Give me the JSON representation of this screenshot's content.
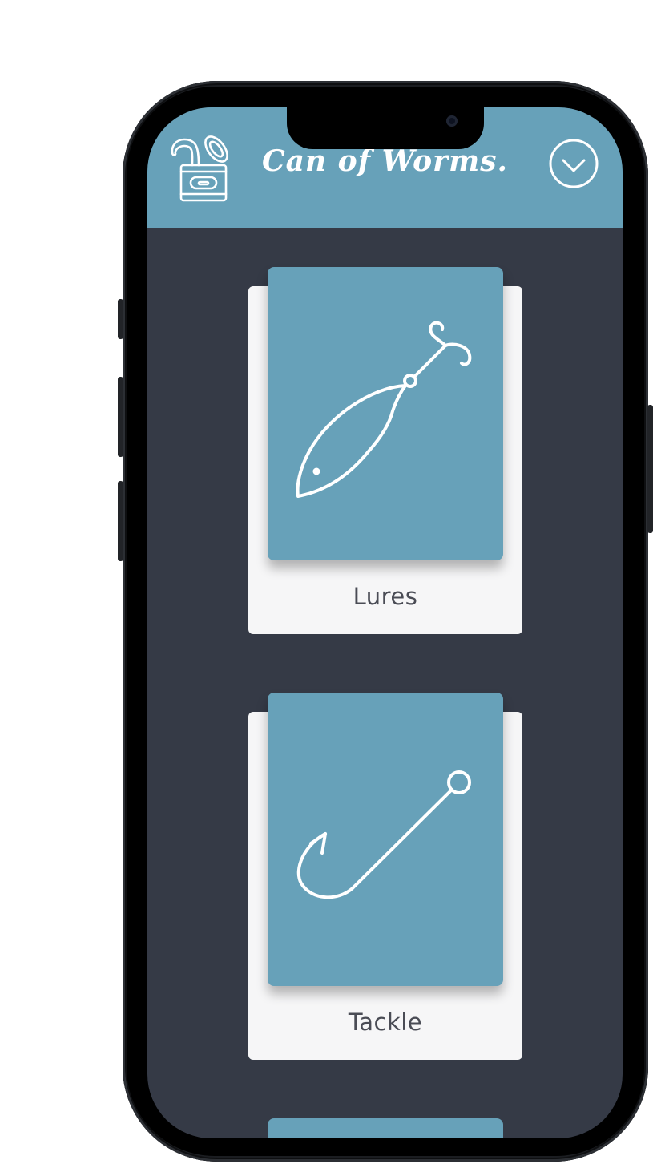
{
  "header": {
    "title": "Can of Worms.",
    "logo_icon": "worm-can-icon",
    "menu_icon": "chevron-down-circle-icon"
  },
  "cards": [
    {
      "label": "Lures",
      "icon": "fishing-lure-icon"
    },
    {
      "label": "Tackle",
      "icon": "fishing-hook-icon"
    }
  ],
  "colors": {
    "accent": "#67a1b9",
    "background": "#353a46",
    "card": "#f6f6f7",
    "label_text": "#4a4c55"
  }
}
